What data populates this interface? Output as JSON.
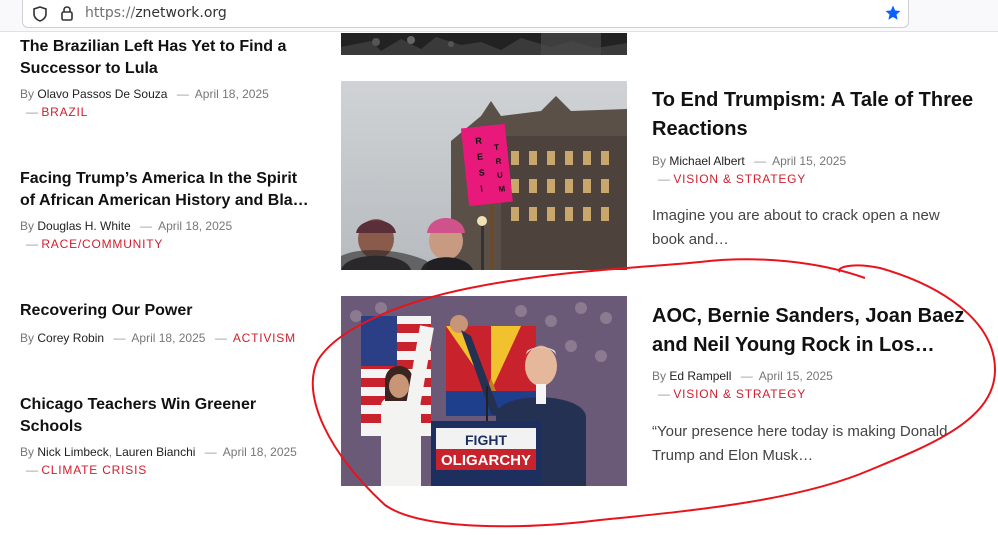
{
  "browser": {
    "url_scheme": "https://",
    "url_host": "znetwork.org"
  },
  "left_articles": [
    {
      "title": "The Brazilian Left Has Yet to Find a Successor to Lula",
      "by": "By",
      "authors": [
        "Olavo Passos De Souza"
      ],
      "date": "April 18, 2025",
      "category": "BRAZIL"
    },
    {
      "title": "Facing Trump’s America In the Spirit of African American History and Bla…",
      "by": "By",
      "authors": [
        "Douglas H. White"
      ],
      "date": "April 18, 2025",
      "category": "RACE/COMMUNITY"
    },
    {
      "title": "Recovering Our Power",
      "by": "By",
      "authors": [
        "Corey Robin"
      ],
      "date": "April 18, 2025",
      "category": "ACTIVISM"
    },
    {
      "title": "Chicago Teachers Win Greener Schools",
      "by": "By",
      "authors": [
        "Nick Limbeck",
        "Lauren Bianchi"
      ],
      "date": "April 18, 2025",
      "category": "CLIMATE CRISIS"
    }
  ],
  "featured_articles": [
    {
      "title": "To End Trumpism: A Tale of Three Reactions",
      "by": "By",
      "author": "Michael Albert",
      "date": "April 15, 2025",
      "category": "VISION & STRATEGY",
      "excerpt": "Imagine you are about to crack open a new book and…",
      "image_sign": "RESIST TRUMP"
    },
    {
      "title": "AOC, Bernie Sanders, Joan Baez and Neil Young Rock in Los…",
      "by": "By",
      "author": "Ed Rampell",
      "date": "April 15, 2025",
      "category": "VISION & STRATEGY",
      "excerpt": "“Your presence here today is making Donald Trump and Elon Musk…",
      "image_podium": [
        "FIGHT",
        "OLIGARCHY"
      ]
    }
  ],
  "colors": {
    "accent": "#d01f2e",
    "annotation": "#e8141c",
    "star": "#0a60ff"
  }
}
